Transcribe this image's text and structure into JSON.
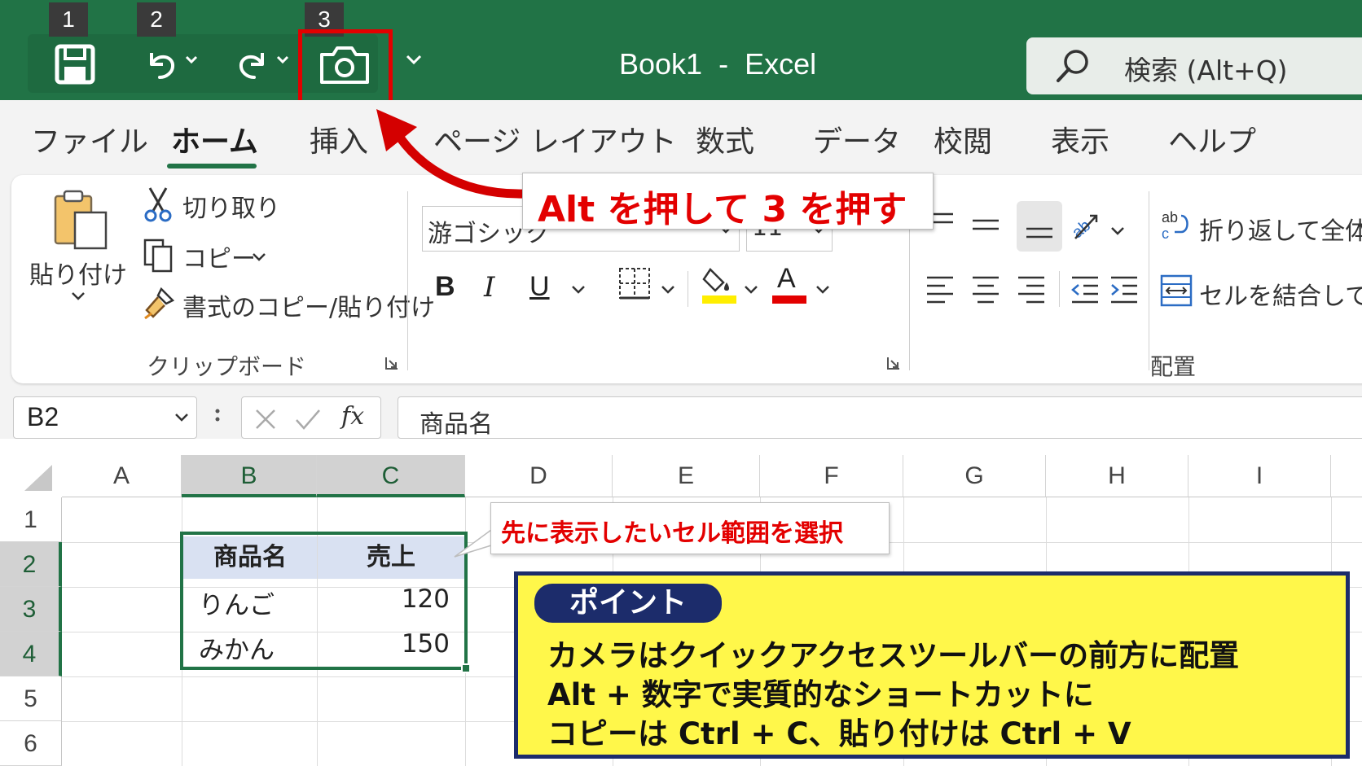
{
  "titlebar": {
    "keytips": [
      "1",
      "2",
      "3"
    ],
    "doc_title": "Book1  -  Excel",
    "search_placeholder": "検索 (Alt+Q)"
  },
  "tabs": [
    "ファイル",
    "ホーム",
    "挿入",
    "ページ レイアウト",
    "数式",
    "データ",
    "校閲",
    "表示",
    "ヘルプ"
  ],
  "active_tab": "ホーム",
  "ribbon": {
    "clipboard": {
      "paste_label": "貼り付け",
      "cut_label": "切り取り",
      "copy_label": "コピー",
      "format_painter_label": "書式のコピー/貼り付け",
      "group_label": "クリップボード"
    },
    "font": {
      "font_name": "游ゴシック",
      "font_size": "11",
      "bold": "B",
      "italic": "I",
      "underline": "U",
      "font_color_glyph": "A",
      "grow_font_glyph": "A",
      "fill_color": "#ffee00",
      "font_color": "#e30000"
    },
    "alignment": {
      "wrap_text_label": "折り返して全体を",
      "merge_label": "セルを結合して中",
      "group_label": "配置"
    }
  },
  "formula_bar": {
    "name_box": "B2",
    "fx": "fx",
    "formula": "商品名"
  },
  "grid": {
    "columns": [
      "A",
      "B",
      "C",
      "D",
      "E",
      "F",
      "G",
      "H",
      "I"
    ],
    "rows": [
      "1",
      "2",
      "3",
      "4",
      "5",
      "6"
    ],
    "table_headers": [
      "商品名",
      "売上"
    ],
    "table_rows": [
      {
        "name": "りんご",
        "sales": "120"
      },
      {
        "name": "みかん",
        "sales": "150"
      }
    ]
  },
  "callouts": {
    "alt_key": "Alt を押して 3 を押す",
    "select_range": "先に表示したいセル範囲を選択"
  },
  "point_box": {
    "tag": "ポイント",
    "lines": [
      "カメラはクイックアクセスツールバーの前方に配置",
      "Alt + 数字で実質的なショートカットに",
      "コピーは Ctrl + C、貼り付けは Ctrl + V"
    ]
  },
  "colors": {
    "excel_green": "#217346",
    "highlight_red": "#e30000",
    "point_yellow": "#fff74a",
    "point_navy": "#1c2c6b",
    "table_header_blue": "#d9e1f2"
  }
}
